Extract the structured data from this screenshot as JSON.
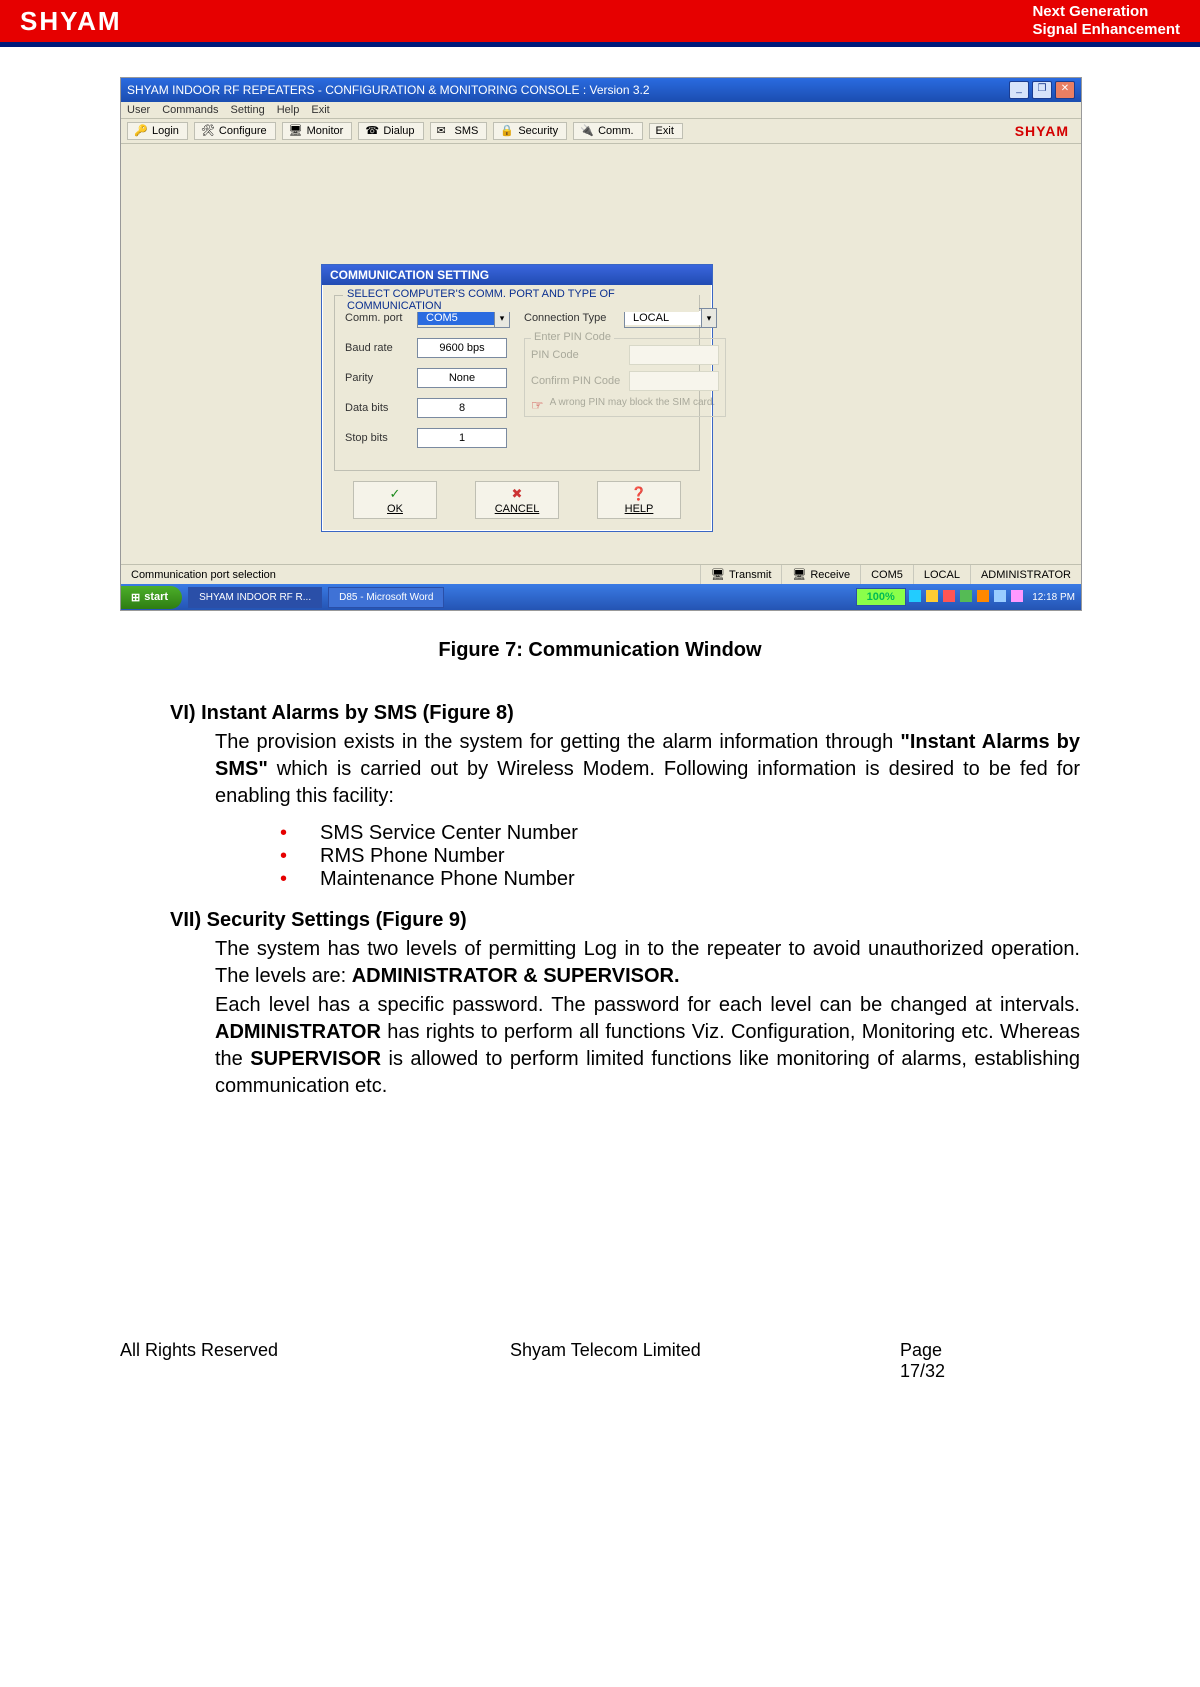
{
  "header": {
    "logo": "SHYAM",
    "tagline_l1": "Next Generation",
    "tagline_l2": "Signal Enhancement"
  },
  "window": {
    "title": "SHYAM INDOOR RF REPEATERS - CONFIGURATION & MONITORING CONSOLE   :  Version 3.2",
    "menus": [
      "User",
      "Commands",
      "Setting",
      "Help",
      "Exit"
    ],
    "toolbar": {
      "login": "Login",
      "configure": "Configure",
      "monitor": "Monitor",
      "dialup": "Dialup",
      "sms": "SMS",
      "security": "Security",
      "comm": "Comm.",
      "exit": "Exit",
      "brand": "SHYAM"
    },
    "dialog": {
      "title": "COMMUNICATION SETTING",
      "fieldset_title": "SELECT COMPUTER'S COMM. PORT AND TYPE OF COMMUNICATION",
      "comm_port_label": "Comm. port",
      "comm_port_value": "COM5",
      "baud_label": "Baud rate",
      "baud_value": "9600 bps",
      "parity_label": "Parity",
      "parity_value": "None",
      "databits_label": "Data bits",
      "databits_value": "8",
      "stopbits_label": "Stop bits",
      "stopbits_value": "1",
      "conntype_label": "Connection Type",
      "conntype_value": "LOCAL",
      "pin_legend": "Enter PIN Code",
      "pin_label": "PIN Code",
      "confirm_pin_label": "Confirm PIN Code",
      "pin_note": "A wrong PIN may block the SIM card.",
      "ok": "OK",
      "cancel": "CANCEL",
      "help": "HELP"
    },
    "statusbar": {
      "msg": "Communication port selection",
      "transmit": "Transmit",
      "receive": "Receive",
      "port": "COM5",
      "mode": "LOCAL",
      "role": "ADMINISTRATOR"
    },
    "taskbar": {
      "start": "start",
      "task1": "SHYAM INDOOR RF R...",
      "task2": "D85 - Microsoft Word",
      "zoom": "100%",
      "clock": "12:18 PM"
    }
  },
  "caption": "Figure 7: Communication Window",
  "sections": {
    "vi_head": "VI) Instant Alarms by SMS (Figure 8)",
    "vi_para_a": "The provision exists in the system for getting the alarm information through ",
    "vi_para_strong": "\"Instant Alarms by SMS\"",
    "vi_para_b": " which is carried out by Wireless Modem.  Following information is desired to be fed for enabling this facility:",
    "bullets": [
      "SMS Service Center Number",
      "RMS Phone Number",
      "Maintenance Phone Number"
    ],
    "vii_head": "VII) Security Settings (Figure 9)",
    "vii_p1_a": "The system has two levels of permitting Log in to the repeater to avoid unauthorized operation. The levels are: ",
    "vii_p1_strong": "ADMINISTRATOR & SUPERVISOR.",
    "vii_p2_a": "Each level has a specific password. The password for each level can be changed at intervals. ",
    "vii_p2_s1": "ADMINISTRATOR",
    "vii_p2_b": " has rights to perform all functions Viz. Configuration, Monitoring etc. Whereas the ",
    "vii_p2_s2": "SUPERVISOR",
    "vii_p2_c": " is allowed to perform limited functions like monitoring of alarms, establishing communication etc."
  },
  "footer": {
    "left": "All Rights Reserved",
    "center": "Shyam Telecom Limited",
    "right_label": "Page",
    "right_num": "17/32"
  }
}
